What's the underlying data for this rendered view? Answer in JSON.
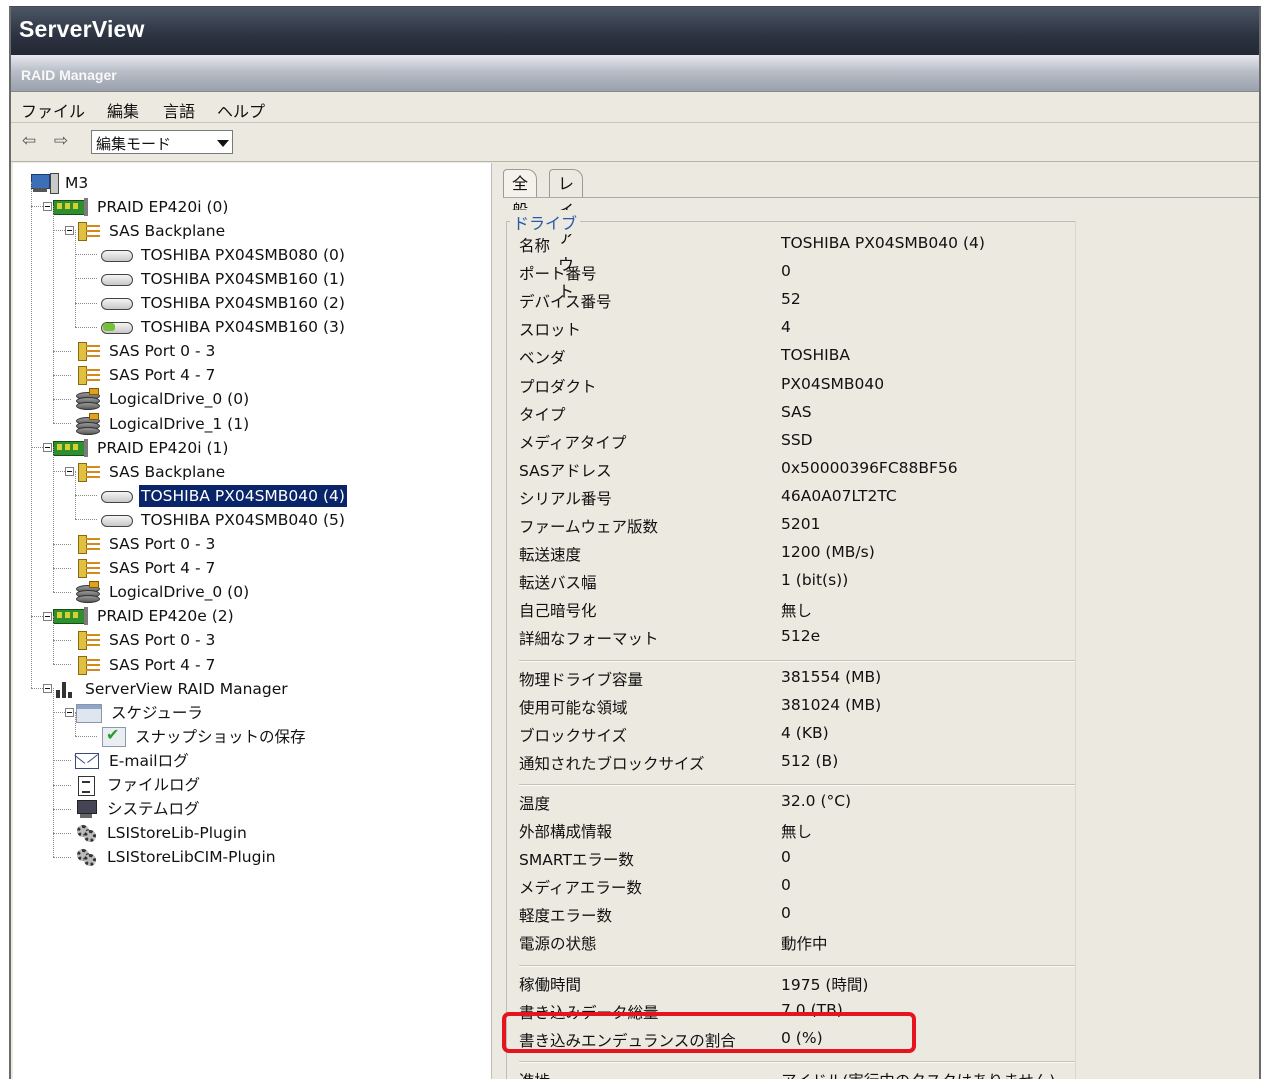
{
  "app": {
    "title": "ServerView",
    "subtitle": "RAID Manager"
  },
  "menu": [
    "ファイル",
    "編集",
    "言語",
    "ヘルプ"
  ],
  "toolbar": {
    "mode_value": "編集モード"
  },
  "tree": [
    {
      "label": "M3",
      "icon": "computer-icon"
    },
    {
      "label": "PRAID EP420i (0)",
      "icon": "raid-controller-icon"
    },
    {
      "label": "SAS Backplane",
      "icon": "backplane-icon"
    },
    {
      "label": "TOSHIBA PX04SMB080 (0)",
      "icon": "disk-icon"
    },
    {
      "label": "TOSHIBA PX04SMB160 (1)",
      "icon": "disk-icon"
    },
    {
      "label": "TOSHIBA PX04SMB160 (2)",
      "icon": "disk-icon"
    },
    {
      "label": "TOSHIBA PX04SMB160 (3)",
      "icon": "disk-hotspare-icon"
    },
    {
      "label": "SAS Port 0 - 3",
      "icon": "sas-port-icon"
    },
    {
      "label": "SAS Port 4 - 7",
      "icon": "sas-port-icon"
    },
    {
      "label": "LogicalDrive_0 (0)",
      "icon": "logical-drive-icon"
    },
    {
      "label": "LogicalDrive_1 (1)",
      "icon": "logical-drive-icon"
    },
    {
      "label": "PRAID EP420i (1)",
      "icon": "raid-controller-icon"
    },
    {
      "label": "SAS Backplane",
      "icon": "backplane-icon"
    },
    {
      "label": "TOSHIBA PX04SMB040 (4)",
      "icon": "disk-icon",
      "selected": true
    },
    {
      "label": "TOSHIBA PX04SMB040 (5)",
      "icon": "disk-icon"
    },
    {
      "label": "SAS Port 0 - 3",
      "icon": "sas-port-icon"
    },
    {
      "label": "SAS Port 4 - 7",
      "icon": "sas-port-icon"
    },
    {
      "label": "LogicalDrive_0 (0)",
      "icon": "logical-drive-icon"
    },
    {
      "label": "PRAID EP420e (2)",
      "icon": "raid-controller-icon"
    },
    {
      "label": "SAS Port 0 - 3",
      "icon": "sas-port-icon"
    },
    {
      "label": "SAS Port 4 - 7",
      "icon": "sas-port-icon"
    },
    {
      "label": "ServerView RAID Manager",
      "icon": "raid-manager-icon"
    },
    {
      "label": "スケジューラ",
      "icon": "scheduler-icon"
    },
    {
      "label": "スナップショットの保存",
      "icon": "snapshot-icon"
    },
    {
      "label": "E-mailログ",
      "icon": "email-log-icon"
    },
    {
      "label": "ファイルログ",
      "icon": "file-log-icon"
    },
    {
      "label": "システムログ",
      "icon": "system-log-icon"
    },
    {
      "label": "LSIStoreLib-Plugin",
      "icon": "plugin-icon"
    },
    {
      "label": "LSIStoreLibCIM-Plugin",
      "icon": "plugin-icon"
    }
  ],
  "tabs": [
    "全般",
    "レイアウト"
  ],
  "detail": {
    "group_title": "ドライブ",
    "sections": [
      [
        {
          "key": "名称",
          "value": "TOSHIBA PX04SMB040 (4)"
        },
        {
          "key": "ポート番号",
          "value": "0"
        },
        {
          "key": "デバイス番号",
          "value": "52"
        },
        {
          "key": "スロット",
          "value": "4"
        },
        {
          "key": "ベンダ",
          "value": "TOSHIBA"
        },
        {
          "key": "プロダクト",
          "value": "PX04SMB040"
        },
        {
          "key": "タイプ",
          "value": "SAS"
        },
        {
          "key": "メディアタイプ",
          "value": "SSD"
        },
        {
          "key": "SASアドレス",
          "value": "0x50000396FC88BF56"
        },
        {
          "key": "シリアル番号",
          "value": "46A0A07LT2TC"
        },
        {
          "key": "ファームウェア版数",
          "value": "5201"
        },
        {
          "key": "転送速度",
          "value": "1200 (MB/s)"
        },
        {
          "key": "転送バス幅",
          "value": "1 (bit(s))"
        },
        {
          "key": "自己暗号化",
          "value": "無し"
        },
        {
          "key": "詳細なフォーマット",
          "value": "512e"
        }
      ],
      [
        {
          "key": "物理ドライブ容量",
          "value": "381554 (MB)"
        },
        {
          "key": "使用可能な領域",
          "value": "381024 (MB)"
        },
        {
          "key": "ブロックサイズ",
          "value": "4 (KB)"
        },
        {
          "key": "通知されたブロックサイズ",
          "value": "512 (B)"
        }
      ],
      [
        {
          "key": "温度",
          "value": "32.0 (°C)"
        },
        {
          "key": "外部構成情報",
          "value": "無し"
        },
        {
          "key": "SMARTエラー数",
          "value": "0"
        },
        {
          "key": "メディアエラー数",
          "value": "0"
        },
        {
          "key": "軽度エラー数",
          "value": "0"
        },
        {
          "key": "電源の状態",
          "value": "動作中"
        }
      ],
      [
        {
          "key": "稼働時間",
          "value": "1975 (時間)"
        },
        {
          "key": "書き込みデータ総量",
          "value": "7.0 (TB)"
        },
        {
          "key": "書き込みエンデュランスの割合",
          "value": "0 (%)",
          "highlighted": true
        }
      ],
      [
        {
          "key": "進捗",
          "value": "アイドル(実行中のタスクはありません)"
        }
      ]
    ]
  },
  "colors": {
    "highlight": "#e6141e",
    "selection": "#0a246a",
    "legend": "#2b5aa5"
  }
}
